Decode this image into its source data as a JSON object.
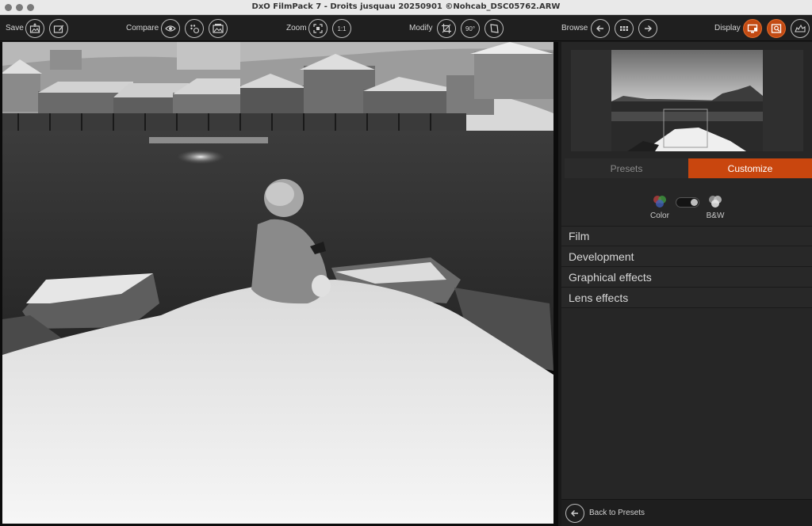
{
  "window": {
    "title": "DxO FilmPack 7 - Droits jusquau 20250901 ©Nohcab_DSC05762.ARW"
  },
  "toolbar": {
    "save": {
      "label": "Save",
      "icons": [
        "export-image-icon",
        "export-edit-icon"
      ]
    },
    "compare": {
      "label": "Compare",
      "icons": [
        "eye-icon",
        "compare-grid-icon",
        "side-by-side-icon"
      ]
    },
    "zoom": {
      "label": "Zoom",
      "icons": [
        "fit-to-screen-icon"
      ],
      "one_to_one": "1:1"
    },
    "modify": {
      "label": "Modify",
      "icons": [
        "crop-icon",
        "rotate-icon",
        "straighten-icon"
      ],
      "rotate_text": "90°"
    },
    "browse": {
      "label": "Browse",
      "icons": [
        "arrow-left-icon",
        "grid-view-icon",
        "arrow-right-icon"
      ]
    },
    "display": {
      "label": "Display",
      "icons": [
        "monitor-icon",
        "loupe-icon",
        "histogram-icon"
      ]
    }
  },
  "panel": {
    "tabs": {
      "presets": "Presets",
      "customize": "Customize",
      "active": "customize"
    },
    "mode": {
      "color": "Color",
      "bw": "B&W",
      "selected": "bw"
    },
    "sections": [
      "Film",
      "Development",
      "Graphical effects",
      "Lens effects"
    ],
    "footer": {
      "back_label": "Back to Presets"
    }
  },
  "colors": {
    "accent": "#c9460e",
    "toolbar_bg": "#1f1f1f",
    "panel_bg": "#262626"
  }
}
